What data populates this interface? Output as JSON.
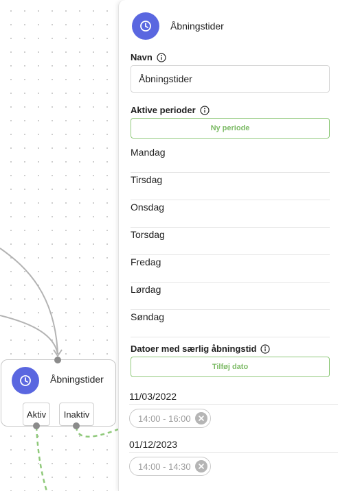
{
  "node": {
    "title": "Åbningstider",
    "outputs": [
      {
        "label": "Aktiv"
      },
      {
        "label": "Inaktiv"
      }
    ],
    "icon": "clock-icon"
  },
  "panel": {
    "title": "Åbningstider",
    "icon": "clock-icon",
    "name_label": "Navn",
    "name_value": "Åbningstider",
    "active_periods_label": "Aktive perioder",
    "new_period_button": "Ny periode",
    "days": [
      "Mandag",
      "Tirsdag",
      "Onsdag",
      "Torsdag",
      "Fredag",
      "Lørdag",
      "Søndag"
    ],
    "special_dates_label": "Datoer med særlig åbningstid",
    "add_date_button": "Tilføj dato",
    "special_dates": [
      {
        "date": "11/03/2022",
        "time": "14:00 - 16:00"
      },
      {
        "date": "01/12/2023",
        "time": "14:00 - 14:30"
      }
    ]
  },
  "colors": {
    "accent": "#5a67e0",
    "green": "#7dbb66",
    "edge_gray": "#b3b3b3",
    "edge_green": "#8fc97a"
  }
}
